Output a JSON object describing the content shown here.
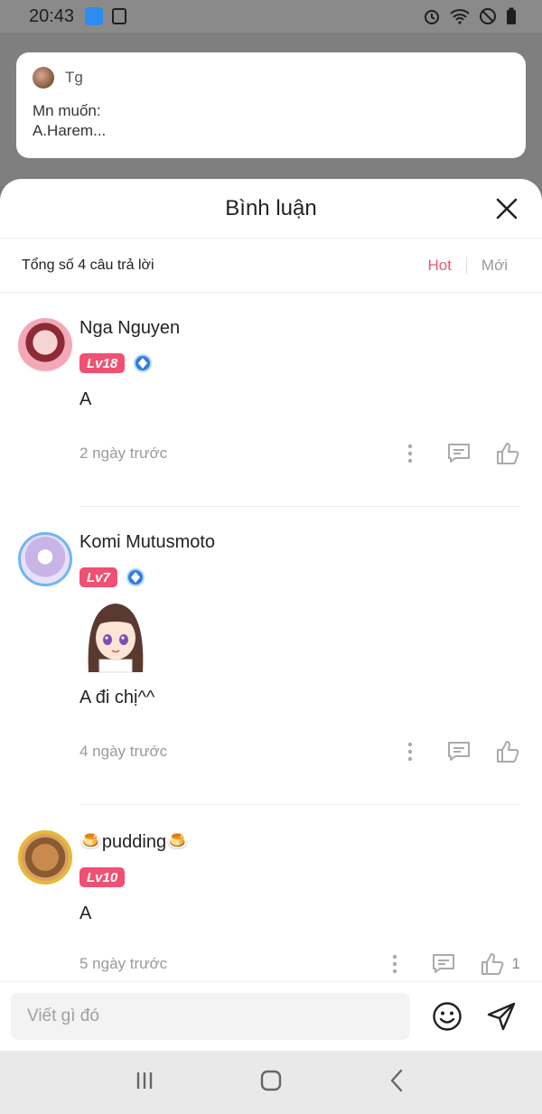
{
  "status_bar": {
    "time": "20:43"
  },
  "notification": {
    "sender": "Tg",
    "message": "Mn muốn:\nA.Harem..."
  },
  "sheet": {
    "title": "Bình luận",
    "total_label": "Tổng số 4 câu trả lời",
    "sort_hot": "Hot",
    "sort_new": "Mới"
  },
  "comments": [
    {
      "name": "Nga Nguyen",
      "level": "Lv18",
      "verified": true,
      "text": "A",
      "time": "2 ngày trước",
      "likes": ""
    },
    {
      "name": "Komi Mutusmoto",
      "level": "Lv7",
      "verified": true,
      "text": "A đi chị^^",
      "time": "4 ngày trước",
      "likes": ""
    },
    {
      "name": "🍮pudding🍮",
      "level": "Lv10",
      "verified": false,
      "text": "A",
      "time": "5 ngày trước",
      "likes": "1"
    }
  ],
  "input": {
    "placeholder": "Viết gì đó"
  },
  "colors": {
    "accent": "#e85a73",
    "level_badge": "#f05072",
    "verify": "#2f7fd8"
  }
}
